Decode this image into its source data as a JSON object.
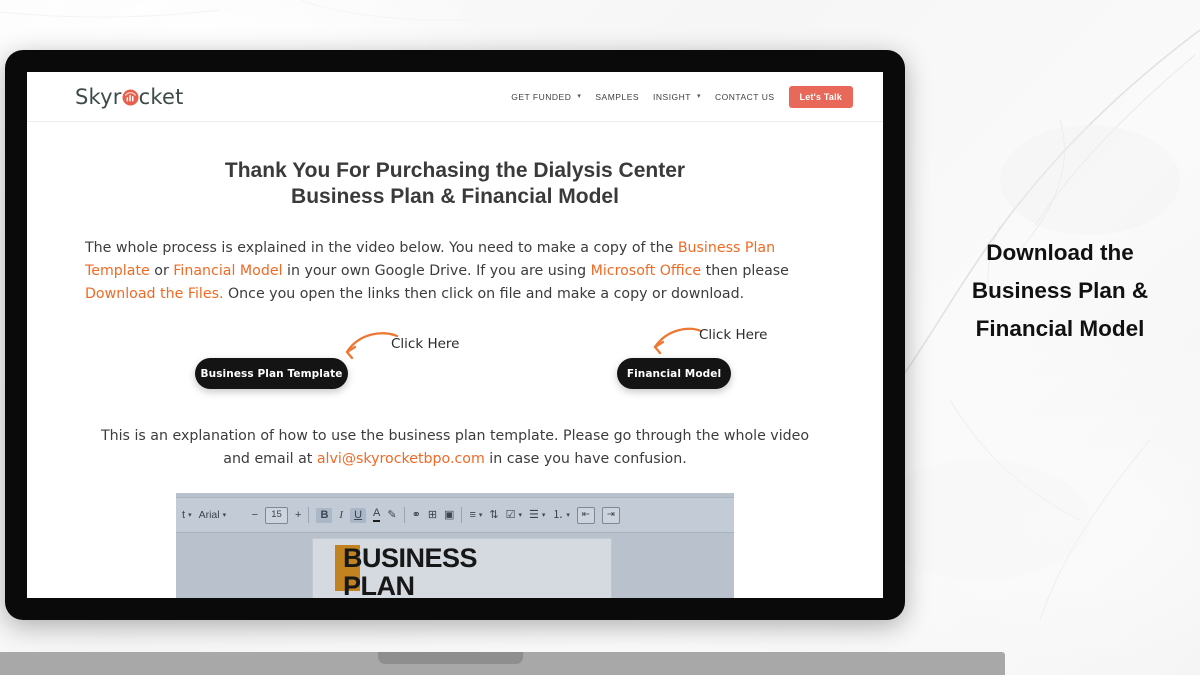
{
  "site": {
    "brand": {
      "prefix": "Skyr",
      "suffix": "cket",
      "icon": "chart-circle-icon"
    },
    "nav": [
      {
        "label": "GET FUNDED",
        "has_dropdown": true
      },
      {
        "label": "SAMPLES",
        "has_dropdown": false
      },
      {
        "label": "INSIGHT",
        "has_dropdown": true
      },
      {
        "label": "CONTACT US",
        "has_dropdown": false
      }
    ],
    "cta": {
      "label": "Let's Talk",
      "color": "#e8685a"
    }
  },
  "page": {
    "title": "Thank You For Purchasing the Dialysis Center Business Plan & Financial Model",
    "intro": {
      "part1": "The whole process is explained in the video below. You need to make a copy of the ",
      "link1": "Business Plan Template",
      "part2": " or ",
      "link2": "Financial Model",
      "part3": " in your own Google Drive. If you are using ",
      "link3": "Microsoft Office",
      "part4": " then please ",
      "link4": "Download the Files.",
      "part5": " Once you open the links then click on file and make a copy or download."
    },
    "buttons": {
      "business_plan": "Business Plan Template",
      "financial_model": "Financial Model",
      "click_here_1": "Click Here",
      "click_here_2": "Click Here",
      "arrow_color": "#ee7733"
    },
    "explanation": {
      "part1": "This is an explanation of how to use the business plan template. Please go through the whole video and email at ",
      "email": "alvi@skyrocketbpo.com",
      "part2": " in case you have confusion."
    },
    "link_color": "#f06a25"
  },
  "video": {
    "toolbar": {
      "style_label": "t",
      "font": "Arial",
      "minus": "−",
      "size": "15",
      "plus": "+",
      "bold": "B",
      "italic": "I",
      "underline": "U",
      "text_color": "A",
      "highlight": "✎",
      "link": "⚭",
      "insert_image": "⊞",
      "insert_comment": "▣",
      "align": "≡",
      "line_spacing": "⇅",
      "checklist": "☑",
      "bulleted_list": "☰",
      "numbered_list": "⒈",
      "indent_decrease": "⇤",
      "indent_increase": "⇥"
    },
    "document": {
      "heading_line1": "BUSINESS",
      "heading_line2": "PLAN"
    }
  },
  "side_caption": {
    "line1": "Download the",
    "line2": "Business Plan &",
    "line3": "Financial Model"
  }
}
